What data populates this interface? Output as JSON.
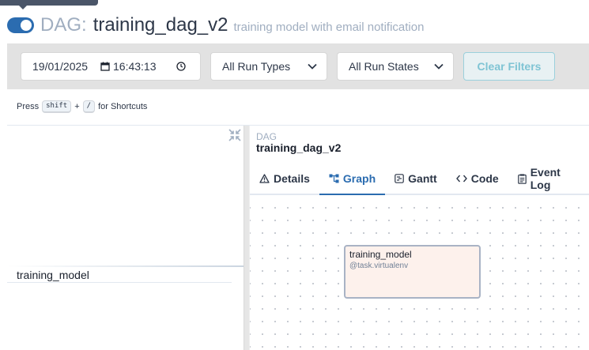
{
  "header": {
    "dag_prefix": "DAG:",
    "dag_name": "training_dag_v2",
    "description": "training model with email notification",
    "paused_toggle_on": true
  },
  "filters": {
    "date_value": "19/01/2025",
    "time_value": "16:43:13",
    "run_type": {
      "selected": "All Run Types"
    },
    "run_state": {
      "selected": "All Run States"
    },
    "clear_label": "Clear Filters"
  },
  "shortcuts": {
    "press": "Press",
    "key1": "shift",
    "plus": "+",
    "key2": "/",
    "suffix": "for Shortcuts"
  },
  "grid": {
    "tasks": [
      {
        "label": "training_model"
      }
    ]
  },
  "breadcrumb": {
    "label": "DAG",
    "name": "training_dag_v2"
  },
  "tabs": [
    {
      "label": "Details",
      "icon": "warning-triangle-icon"
    },
    {
      "label": "Graph",
      "icon": "graph-icon",
      "active": true
    },
    {
      "label": "Gantt",
      "icon": "gantt-icon"
    },
    {
      "label": "Code",
      "icon": "code-icon"
    },
    {
      "label": "Event Log",
      "icon": "event-log-icon"
    }
  ],
  "graph": {
    "nodes": [
      {
        "title": "training_model",
        "operator": "@task.virtualenv"
      }
    ]
  },
  "colors": {
    "accent": "#2b6cb0",
    "filter_bar_bg": "#e2e2e2",
    "clear_button_text": "#7fc4d4",
    "node_bg": "#fdf1ec",
    "node_border": "#a9b3c5"
  }
}
